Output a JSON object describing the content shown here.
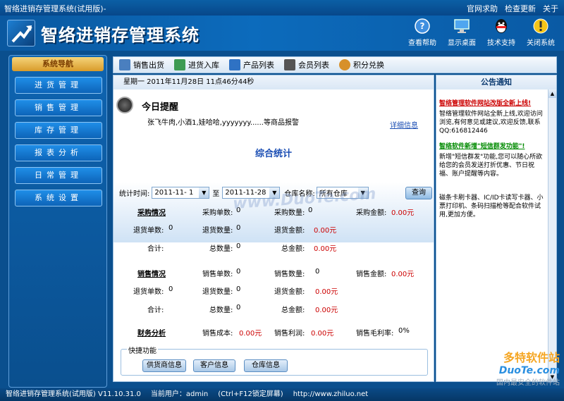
{
  "window": {
    "title": "智络进销存管理系统(试用版)-",
    "links": [
      "官网求助",
      "检查更新",
      "关于"
    ]
  },
  "header": {
    "app_name": "智络进销存管理系统",
    "buttons": [
      {
        "label": "查看帮助",
        "icon": "help-icon"
      },
      {
        "label": "显示桌面",
        "icon": "desktop-icon"
      },
      {
        "label": "技术支持",
        "icon": "qq-icon"
      },
      {
        "label": "关闭系统",
        "icon": "warning-icon"
      }
    ]
  },
  "sidebar": {
    "title": "系统导航",
    "items": [
      "进货管理",
      "销售管理",
      "库存管理",
      "报表分析",
      "日常管理",
      "系统设置"
    ]
  },
  "toolbar": {
    "items": [
      {
        "label": "销售出货",
        "icon": "sales-out-icon",
        "color": "#4a7fbf"
      },
      {
        "label": "进货入库",
        "icon": "stock-in-icon",
        "color": "#3d9b52"
      },
      {
        "label": "产品列表",
        "icon": "product-list-icon",
        "color": "#2f72c4"
      },
      {
        "label": "会员列表",
        "icon": "member-list-icon",
        "color": "#555555"
      },
      {
        "label": "积分兑换",
        "icon": "points-icon",
        "color": "#d7902a"
      }
    ]
  },
  "main": {
    "date_line": "星期一  2011年11月28日 11点46分44秒",
    "reminder_title": "今日提醒",
    "reminder_text": "张飞牛肉,小酒1,娃哈哈,yyyyyyy......等商品报警",
    "detail_link": "详细信息",
    "stat_title": "综合统计",
    "query": {
      "time_label": "统计时间:",
      "from": "2011-11- 1",
      "to_label": "至",
      "to": "2011-11-28",
      "warehouse_label": "仓库名称:",
      "warehouse": "所有仓库",
      "button": "查询"
    },
    "purchase": {
      "title": "采购情况",
      "row1": [
        "采购单数:",
        "0",
        "采购数量:",
        "0",
        "采购金额:",
        "0.00元"
      ],
      "row2": [
        "退货单数:",
        "0",
        "退货数量:",
        "0",
        "退货金额:",
        "0.00元"
      ],
      "row3": [
        "合计:",
        "总数量:",
        "0",
        "总金额:",
        "0.00元"
      ]
    },
    "sales": {
      "title": "销售情况",
      "row1": [
        "销售单数:",
        "0",
        "销售数量:",
        "0",
        "销售金额:",
        "0.00元"
      ],
      "row2": [
        "退货单数:",
        "0",
        "退货数量:",
        "0",
        "退货金额:",
        "0.00元"
      ],
      "row3": [
        "合计:",
        "总数量:",
        "0",
        "总金额:",
        "0.00元"
      ]
    },
    "finance": {
      "title": "财务分析",
      "cost_label": "销售成本:",
      "cost": "0.00元",
      "profit_label": "销售利润:",
      "profit": "0.00元",
      "margin_label": "销售毛利率:",
      "margin": "0%"
    },
    "quick": {
      "legend": "快捷功能",
      "buttons": [
        "供货商信息",
        "客户信息",
        "仓库信息"
      ]
    }
  },
  "notice": {
    "title": "公告通知",
    "headline": "智络管理软件网站改版全新上线!",
    "p1": "智络管理软件网站全新上线,欢迎访问浏览,有何意见或建议,欢迎反馈,联系QQ:616812446",
    "headline2": "智络软件新增\"短信群发功能\"!",
    "p2": "新增\"短信群发\"功能,您可以随心所欲给您的会员发送打折优惠、节日祝福、账户提醒等内容。",
    "p3": "磁条卡刷卡器、IC/ID卡读写卡器、小票打印机、条码扫描枪等配合软件试用,更加方便。"
  },
  "statusbar": {
    "version": "智络进销存管理系统(试用版) V11.10.31.0",
    "user": "当前用户：admin",
    "hint": "(Ctrl+F12锁定屏幕)",
    "url": "http://www.zhiluo.net"
  },
  "watermark": {
    "center": "www.DuoTe.com",
    "corner_a": "多特软件站",
    "corner_b": "DuoTe.com",
    "corner_c": "国内最安全的软件站"
  }
}
